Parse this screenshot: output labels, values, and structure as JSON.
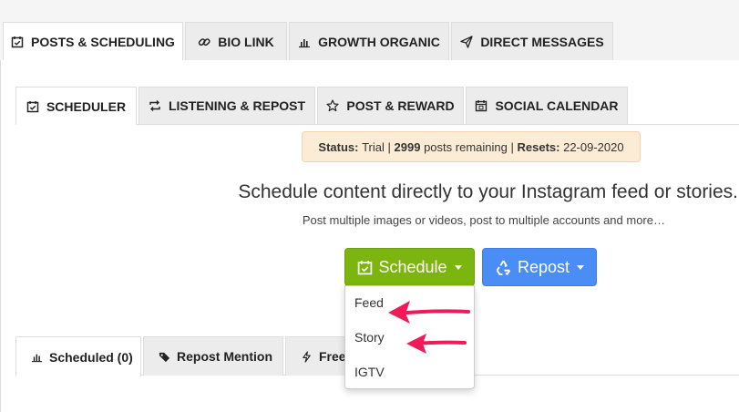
{
  "top_tabs": [
    {
      "label": "POSTS & SCHEDULING",
      "icon": "calendar-check-icon",
      "active": true
    },
    {
      "label": "BIO LINK",
      "icon": "link-icon",
      "active": false
    },
    {
      "label": "GROWTH ORGANIC",
      "icon": "bar-chart-icon",
      "active": false
    },
    {
      "label": "DIRECT MESSAGES",
      "icon": "paper-plane-icon",
      "active": false
    }
  ],
  "sub_tabs": [
    {
      "label": "SCHEDULER",
      "icon": "calendar-check-icon",
      "active": true
    },
    {
      "label": "LISTENING & REPOST",
      "icon": "retweet-icon",
      "active": false
    },
    {
      "label": "POST & REWARD",
      "icon": "star-icon",
      "active": false
    },
    {
      "label": "SOCIAL CALENDAR",
      "icon": "calendar-icon",
      "active": false
    }
  ],
  "status": {
    "status_label": "Status:",
    "status_value": "Trial",
    "sep1": "|",
    "posts_count": "2999",
    "posts_text": "posts remaining",
    "sep2": "|",
    "resets_label": "Resets:",
    "resets_value": "22-09-2020"
  },
  "headline": "Schedule content directly to your Instagram feed or stories.",
  "subline": "Post multiple images or videos, post to multiple accounts and more…",
  "buttons": {
    "schedule": "Schedule",
    "repost": "Repost"
  },
  "dropdown": {
    "items": [
      "Feed",
      "Story",
      "IGTV"
    ]
  },
  "bottom_tabs": [
    {
      "label": "Scheduled (0)",
      "icon": "bar-chart-icon",
      "active": true
    },
    {
      "label": "Repost Mention",
      "icon": "tag-icon",
      "active": false
    },
    {
      "label": "Free",
      "icon": "bolt-icon",
      "active": false
    }
  ],
  "colors": {
    "schedule_button": "#7cb50f",
    "repost_button": "#4a8ef5",
    "status_bg": "#fcecd6",
    "annotation_arrow": "#f0195a"
  }
}
